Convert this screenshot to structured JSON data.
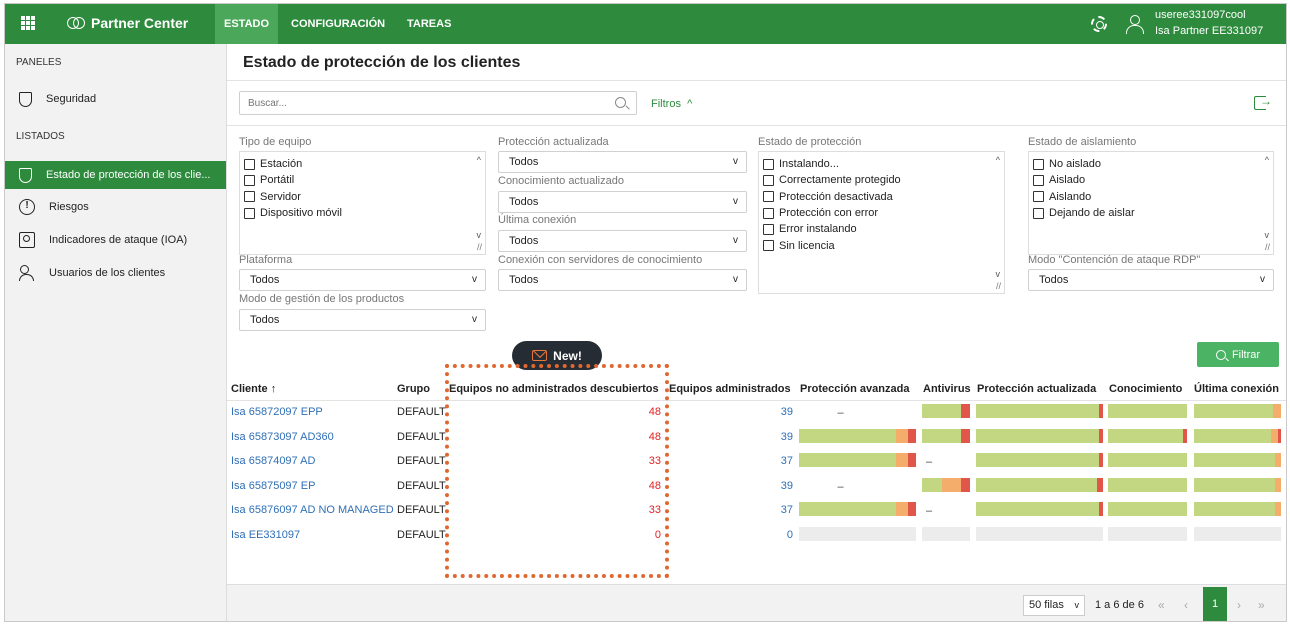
{
  "topbar": {
    "brand": "Partner Center",
    "tabs": [
      {
        "label": "ESTADO",
        "active": true
      },
      {
        "label": "CONFIGURACIÓN",
        "active": false
      },
      {
        "label": "TAREAS",
        "active": false
      }
    ],
    "username": "useree331097cool",
    "account": "Isa Partner EE331097",
    "icons": [
      "apps-grid-icon",
      "settings-icon",
      "user-icon"
    ]
  },
  "sidebar": {
    "section_panels": "PANELES",
    "panels": [
      {
        "label": "Seguridad",
        "icon": "shield-icon"
      }
    ],
    "section_lists": "LISTADOS",
    "lists": [
      {
        "label": "Estado de protección de los clie...",
        "icon": "shield-icon",
        "active": true
      },
      {
        "label": "Riesgos",
        "icon": "alert-icon",
        "active": false
      },
      {
        "label": "Indicadores de ataque (IOA)",
        "icon": "ioa-icon",
        "active": false
      },
      {
        "label": "Usuarios de los clientes",
        "icon": "users-icon",
        "active": false
      }
    ]
  },
  "main": {
    "title": "Estado de protección de los clientes",
    "search_placeholder": "Buscar...",
    "filters_label": "Filtros",
    "filter_button": "Filtrar",
    "new_badge": "New!"
  },
  "filters": {
    "tipo_equipo": {
      "label": "Tipo de equipo",
      "options": [
        "Estación",
        "Portátil",
        "Servidor",
        "Dispositivo móvil"
      ]
    },
    "plataforma": {
      "label": "Plataforma",
      "value": "Todos"
    },
    "modo_gestion": {
      "label": "Modo de gestión de los productos",
      "value": "Todos"
    },
    "proteccion_actualizada": {
      "label": "Protección actualizada",
      "value": "Todos"
    },
    "conocimiento_actualizado": {
      "label": "Conocimiento actualizado",
      "value": "Todos"
    },
    "ultima_conexion": {
      "label": "Última conexión",
      "value": "Todos"
    },
    "conexion_servidores": {
      "label": "Conexión con servidores de conocimiento",
      "value": "Todos"
    },
    "estado_proteccion": {
      "label": "Estado de protección",
      "options": [
        "Instalando...",
        "Correctamente protegido",
        "Protección desactivada",
        "Protección con error",
        "Error instalando",
        "Sin licencia"
      ]
    },
    "estado_aislamiento": {
      "label": "Estado de aislamiento",
      "options": [
        "No aislado",
        "Aislado",
        "Aislando",
        "Dejando de aislar"
      ]
    },
    "modo_rdp": {
      "label": "Modo \"Contención de ataque RDP\"",
      "value": "Todos"
    }
  },
  "table": {
    "headers": {
      "cliente": "Cliente ↑",
      "grupo": "Grupo",
      "no_admin": "Equipos no administrados descubiertos",
      "admin": "Equipos administrados",
      "prot_avanzada": "Protección avanzada",
      "antivirus": "Antivirus",
      "prot_actualizada": "Protección actualizada",
      "conocimiento": "Conocimiento",
      "ultima_conexion": "Última conexión"
    },
    "rows": [
      {
        "cliente": "Isa 65872097 EPP",
        "grupo": "DEFAULT",
        "no_admin": "48",
        "admin": "39",
        "prot_avanzada": "–"
      },
      {
        "cliente": "Isa 65873097 AD360",
        "grupo": "DEFAULT",
        "no_admin": "48",
        "admin": "39"
      },
      {
        "cliente": "Isa 65874097 AD",
        "grupo": "DEFAULT",
        "no_admin": "33",
        "admin": "37",
        "antivirus": "–"
      },
      {
        "cliente": "Isa 65875097 EP",
        "grupo": "DEFAULT",
        "no_admin": "48",
        "admin": "39",
        "prot_avanzada": "–"
      },
      {
        "cliente": "Isa 65876097 AD NO MANAGED",
        "grupo": "DEFAULT",
        "no_admin": "33",
        "admin": "37",
        "antivirus": "–"
      },
      {
        "cliente": "Isa EE331097",
        "grupo": "DEFAULT",
        "no_admin": "0",
        "admin": "0"
      }
    ],
    "status_colors": {
      "ok": "#c3d682",
      "warning": "#f4ad6a",
      "error": "#e0564a",
      "empty": "#ececec"
    },
    "bars": [
      {
        "prot_avanzada": null,
        "antivirus": [
          0.82,
          0,
          0.18
        ],
        "prot_actualizada": [
          0.97,
          0,
          0.03
        ],
        "conocimiento": [
          1,
          0,
          0
        ],
        "ultima_conexion": [
          0.91,
          0.09,
          0
        ]
      },
      {
        "prot_avanzada": [
          0.83,
          0.1,
          0.07
        ],
        "antivirus": [
          0.82,
          0,
          0.18
        ],
        "prot_actualizada": [
          0.97,
          0,
          0.03
        ],
        "conocimiento": [
          0.95,
          0,
          0.05
        ],
        "ultima_conexion": [
          0.88,
          0.08,
          0.04
        ]
      },
      {
        "prot_avanzada": [
          0.83,
          0.1,
          0.07
        ],
        "antivirus": null,
        "prot_actualizada": [
          0.97,
          0,
          0.03
        ],
        "conocimiento": [
          1,
          0,
          0
        ],
        "ultima_conexion": [
          0.93,
          0.07,
          0
        ]
      },
      {
        "prot_avanzada": null,
        "antivirus": [
          0.42,
          0.4,
          0.18
        ],
        "prot_actualizada": [
          0.95,
          0,
          0.05
        ],
        "conocimiento": [
          1,
          0,
          0
        ],
        "ultima_conexion": [
          0.93,
          0.07,
          0
        ]
      },
      {
        "prot_avanzada": [
          0.83,
          0.1,
          0.07
        ],
        "antivirus": null,
        "prot_actualizada": [
          0.97,
          0,
          0.03
        ],
        "conocimiento": [
          1,
          0,
          0
        ],
        "ultima_conexion": [
          0.93,
          0.07,
          0
        ]
      },
      {
        "prot_avanzada": [
          0,
          0,
          0
        ],
        "antivirus": [
          0,
          0,
          0
        ],
        "prot_actualizada": [
          0,
          0,
          0
        ],
        "conocimiento": [
          0,
          0,
          0
        ],
        "ultima_conexion": [
          0,
          0,
          0
        ]
      }
    ]
  },
  "pagination": {
    "rows_per_page": "50 filas",
    "range": "1 a 6 de 6",
    "first": "«",
    "prev": "‹",
    "current": "1",
    "next": "›",
    "last": "»"
  }
}
